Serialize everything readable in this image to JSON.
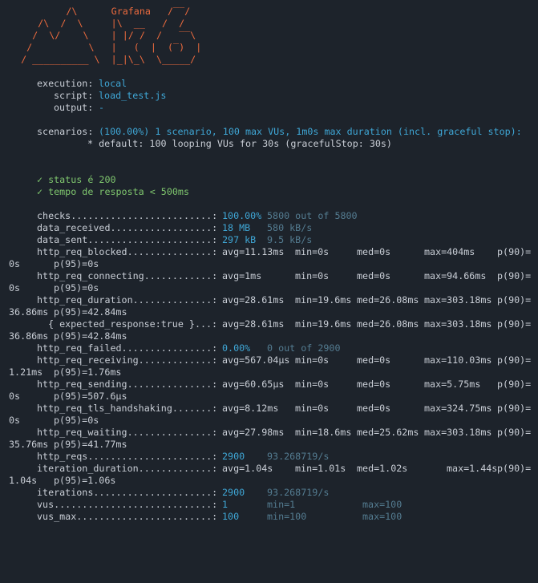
{
  "logo": {
    "brand": "Grafana",
    "art": [
      "          /\\      Grafana   /‾‾/",
      "     /\\  /  \\     |\\  __   /  /",
      "    /  \\/    \\    | |/ /  /   ‾‾\\",
      "   /          \\   |   (  |  (‾)  |",
      "  / __________ \\  |_|\\_\\  \\_____/"
    ]
  },
  "run": {
    "execution_label": "execution:",
    "execution_value": "local",
    "script_label": "script:",
    "script_value": "load_test.js",
    "output_label": "output:",
    "output_value": "-",
    "scenarios_label": "scenarios:",
    "scenarios_value": "(100.00%) 1 scenario, 100 max VUs, 1m0s max duration (incl. graceful stop):",
    "default_line": "* default: 100 looping VUs for 30s (gracefulStop: 30s)"
  },
  "checks": [
    "✓ status é 200",
    "✓ tempo de resposta < 500ms"
  ],
  "metrics": {
    "checks": {
      "name": "checks.........................:",
      "v1": "100.00%",
      "v2": "5800 out of 5800"
    },
    "data_received": {
      "name": "data_received..................:",
      "v1": "18 MB",
      "v2": "580 kB/s"
    },
    "data_sent": {
      "name": "data_sent......................:",
      "v1": "297 kB",
      "v2": "9.5 kB/s"
    },
    "blocked": {
      "name": "http_req_blocked...............:",
      "avg": "avg=11.13ms",
      "min": "min=0s",
      "med": "med=0s",
      "max": "max=404ms",
      "p90": "p(90)=",
      "p90v": "0s",
      "p95": "p(95)=0s"
    },
    "connecting": {
      "name": "http_req_connecting............:",
      "avg": "avg=1ms",
      "min": "min=0s",
      "med": "med=0s",
      "max": "max=94.66ms",
      "p90": "p(90)=",
      "p90v": "0s",
      "p95": "p(95)=0s"
    },
    "duration": {
      "name": "http_req_duration..............:",
      "avg": "avg=28.61ms",
      "min": "min=19.6ms",
      "med": "med=26.08ms",
      "max": "max=303.18ms",
      "p90": "p(90)=",
      "p90v": "36.86ms",
      "p95": "p(95)=42.84ms"
    },
    "expected": {
      "name": "{ expected_response:true }...:",
      "avg": "avg=28.61ms",
      "min": "min=19.6ms",
      "med": "med=26.08ms",
      "max": "max=303.18ms",
      "p90": "p(90)=",
      "p90v": "36.86ms",
      "p95": "p(95)=42.84ms"
    },
    "failed": {
      "name": "http_req_failed................:",
      "v1": "0.00%",
      "v2": "0 out of 2900"
    },
    "receiving": {
      "name": "http_req_receiving.............:",
      "avg": "avg=567.04µs",
      "min": "min=0s",
      "med": "med=0s",
      "max": "max=110.03ms",
      "p90": "p(90)=",
      "p90v": "1.21ms",
      "p95": "p(95)=1.76ms"
    },
    "sending": {
      "name": "http_req_sending...............:",
      "avg": "avg=60.65µs",
      "min": "min=0s",
      "med": "med=0s",
      "max": "max=5.75ms",
      "p90": "p(90)=",
      "p90v": "0s",
      "p95": "p(95)=507.6µs"
    },
    "tls": {
      "name": "http_req_tls_handshaking.......:",
      "avg": "avg=8.12ms",
      "min": "min=0s",
      "med": "med=0s",
      "max": "max=324.75ms",
      "p90": "p(90)=",
      "p90v": "0s",
      "p95": "p(95)=0s"
    },
    "waiting": {
      "name": "http_req_waiting...............:",
      "avg": "avg=27.98ms",
      "min": "min=18.6ms",
      "med": "med=25.62ms",
      "max": "max=303.18ms",
      "p90": "p(90)=",
      "p90v": "35.76ms",
      "p95": "p(95)=41.77ms"
    },
    "reqs": {
      "name": "http_reqs......................:",
      "v1": "2900",
      "v2": "93.268719/s"
    },
    "iter_duration": {
      "name": "iteration_duration.............:",
      "avg": "avg=1.04s",
      "min": "min=1.01s",
      "med": "med=1.02s",
      "max": "max=1.44s",
      "p90": "p(90)=",
      "p90v": "1.04s",
      "p95": "p(95)=1.06s"
    },
    "iterations": {
      "name": "iterations.....................:",
      "v1": "2900",
      "v2": "93.268719/s"
    },
    "vus": {
      "name": "vus............................:",
      "v1": "1",
      "v2": "min=1",
      "v3": "max=100"
    },
    "vus_max": {
      "name": "vus_max........................:",
      "v1": "100",
      "v2": "min=100",
      "v3": "max=100"
    }
  }
}
